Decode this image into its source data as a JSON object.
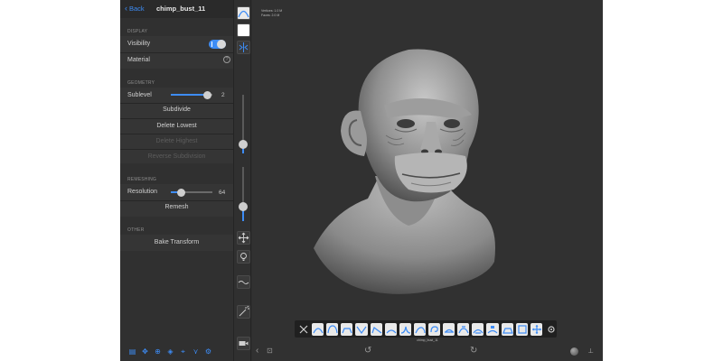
{
  "header": {
    "back_label": "Back",
    "file_name": "chimp_bust_11"
  },
  "display": {
    "section_label": "DISPLAY",
    "visibility_label": "Visibility",
    "visibility_on": true,
    "material_label": "Material",
    "help_glyph": "?"
  },
  "geometry": {
    "section_label": "GEOMETRY",
    "sublevel_label": "Sublevel",
    "sublevel_value": "2",
    "subdivide_label": "Subdivide",
    "delete_lowest_label": "Delete Lowest",
    "delete_highest_label": "Delete Highest",
    "reverse_subdivision_label": "Reverse Subdivision"
  },
  "remeshing": {
    "section_label": "REMESHING",
    "resolution_label": "Resolution",
    "resolution_value": "64",
    "remesh_label": "Remesh"
  },
  "other": {
    "section_label": "OTHER",
    "bake_transform_label": "Bake Transform"
  },
  "bottom_tools": [
    "scene-icon",
    "move-icon",
    "symmetry-icon",
    "topology-icon",
    "camera-icon",
    "nodes-icon",
    "settings-icon"
  ],
  "viewport": {
    "stats_line1": "Vertices: 1.0 M",
    "stats_line2": "Faces: 2.0 M",
    "scene_label": "chimp_bust_11"
  },
  "brush_tools": [
    "close-icon",
    "brush",
    "inflate",
    "clay",
    "crease",
    "flatten",
    "smooth",
    "pinch",
    "drag",
    "twist",
    "mask",
    "move",
    "local-scale",
    "paint",
    "trim",
    "transform",
    "gizmo"
  ],
  "colors": {
    "accent": "#3d8cf5",
    "panel": "#303030",
    "viewport": "#313131"
  }
}
